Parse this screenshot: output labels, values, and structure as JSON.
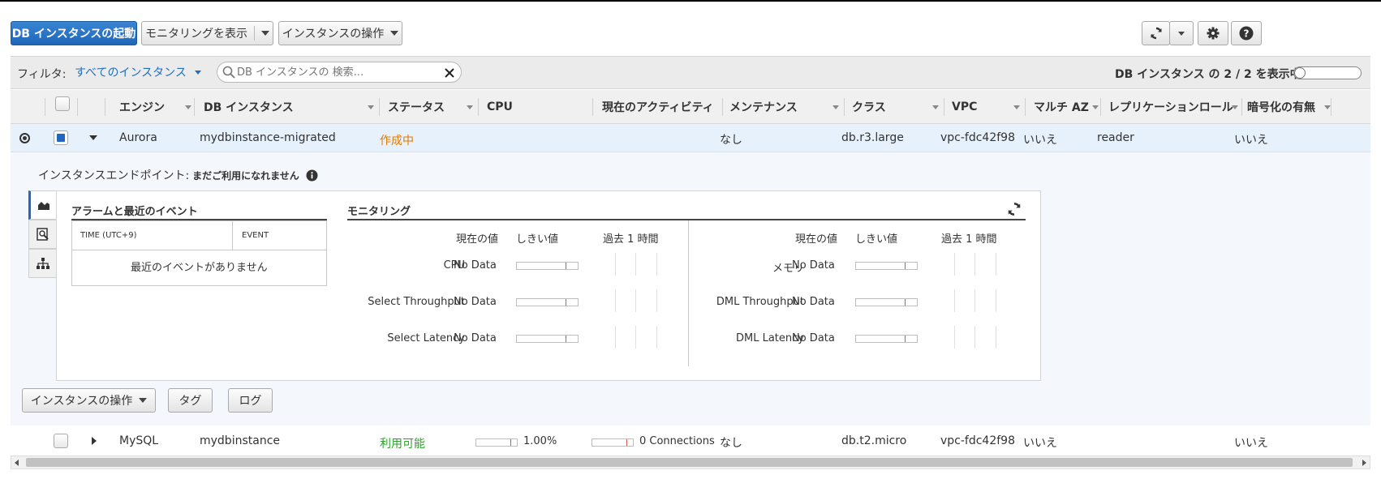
{
  "toolbar": {
    "launch_label": "DB インスタンスの起動",
    "monitoring_label": "モニタリングを表示",
    "instance_actions_label": "インスタンスの操作"
  },
  "filter": {
    "label": "フィルタ:",
    "selected": "すべてのインスタンス",
    "search_placeholder": "DB インスタンスの 検索...",
    "count_text": "DB インスタンス の 2 / 2 を表示中"
  },
  "columns": [
    "エンジン",
    "DB インスタンス",
    "ステータス",
    "CPU",
    "現在のアクティビティ",
    "メンテナンス",
    "クラス",
    "VPC",
    "マルチ AZ",
    "レプリケーションロール",
    "暗号化の有無"
  ],
  "rows": [
    {
      "engine": "Aurora",
      "instance": "mydbinstance-migrated",
      "status": "作成中",
      "cpu": "",
      "activity": "",
      "maintenance": "なし",
      "class": "db.r3.large",
      "vpc": "vpc-fdc42f98",
      "multi_az": "いいえ",
      "replication": "reader",
      "encrypted": "いいえ"
    },
    {
      "engine": "MySQL",
      "instance": "mydbinstance",
      "status": "利用可能",
      "cpu": "1.00%",
      "activity": "0 Connections",
      "maintenance": "なし",
      "class": "db.t2.micro",
      "vpc": "vpc-fdc42f98",
      "multi_az": "いいえ",
      "replication": "",
      "encrypted": "いいえ"
    }
  ],
  "detail": {
    "endpoint_label": "インスタンスエンドポイント:",
    "endpoint_value": "まだご利用になれません",
    "alarms_title": "アラームと最近のイベント",
    "time_header": "TIME (UTC+9)",
    "event_header": "EVENT",
    "no_events": "最近のイベントがありません",
    "monitoring_title": "モニタリング",
    "current_value_header": "現在の値",
    "threshold_header": "しきい値",
    "last_hour_header": "過去 1 時間",
    "metrics_left": [
      {
        "name": "CPU",
        "value": "No Data"
      },
      {
        "name": "Select Throughput",
        "value": "No Data"
      },
      {
        "name": "Select Latency",
        "value": "No Data"
      }
    ],
    "metrics_right": [
      {
        "name": "メモリ",
        "value": "No Data"
      },
      {
        "name": "DML Throughput",
        "value": "No Data"
      },
      {
        "name": "DML Latency",
        "value": "No Data"
      }
    ],
    "actions_label": "インスタンスの操作",
    "tags_label": "タグ",
    "logs_label": "ログ"
  },
  "colors": {
    "primary": "#2268bd",
    "link": "#1f6fbf",
    "creating": "#e07b00",
    "available": "#2e9e2e"
  }
}
